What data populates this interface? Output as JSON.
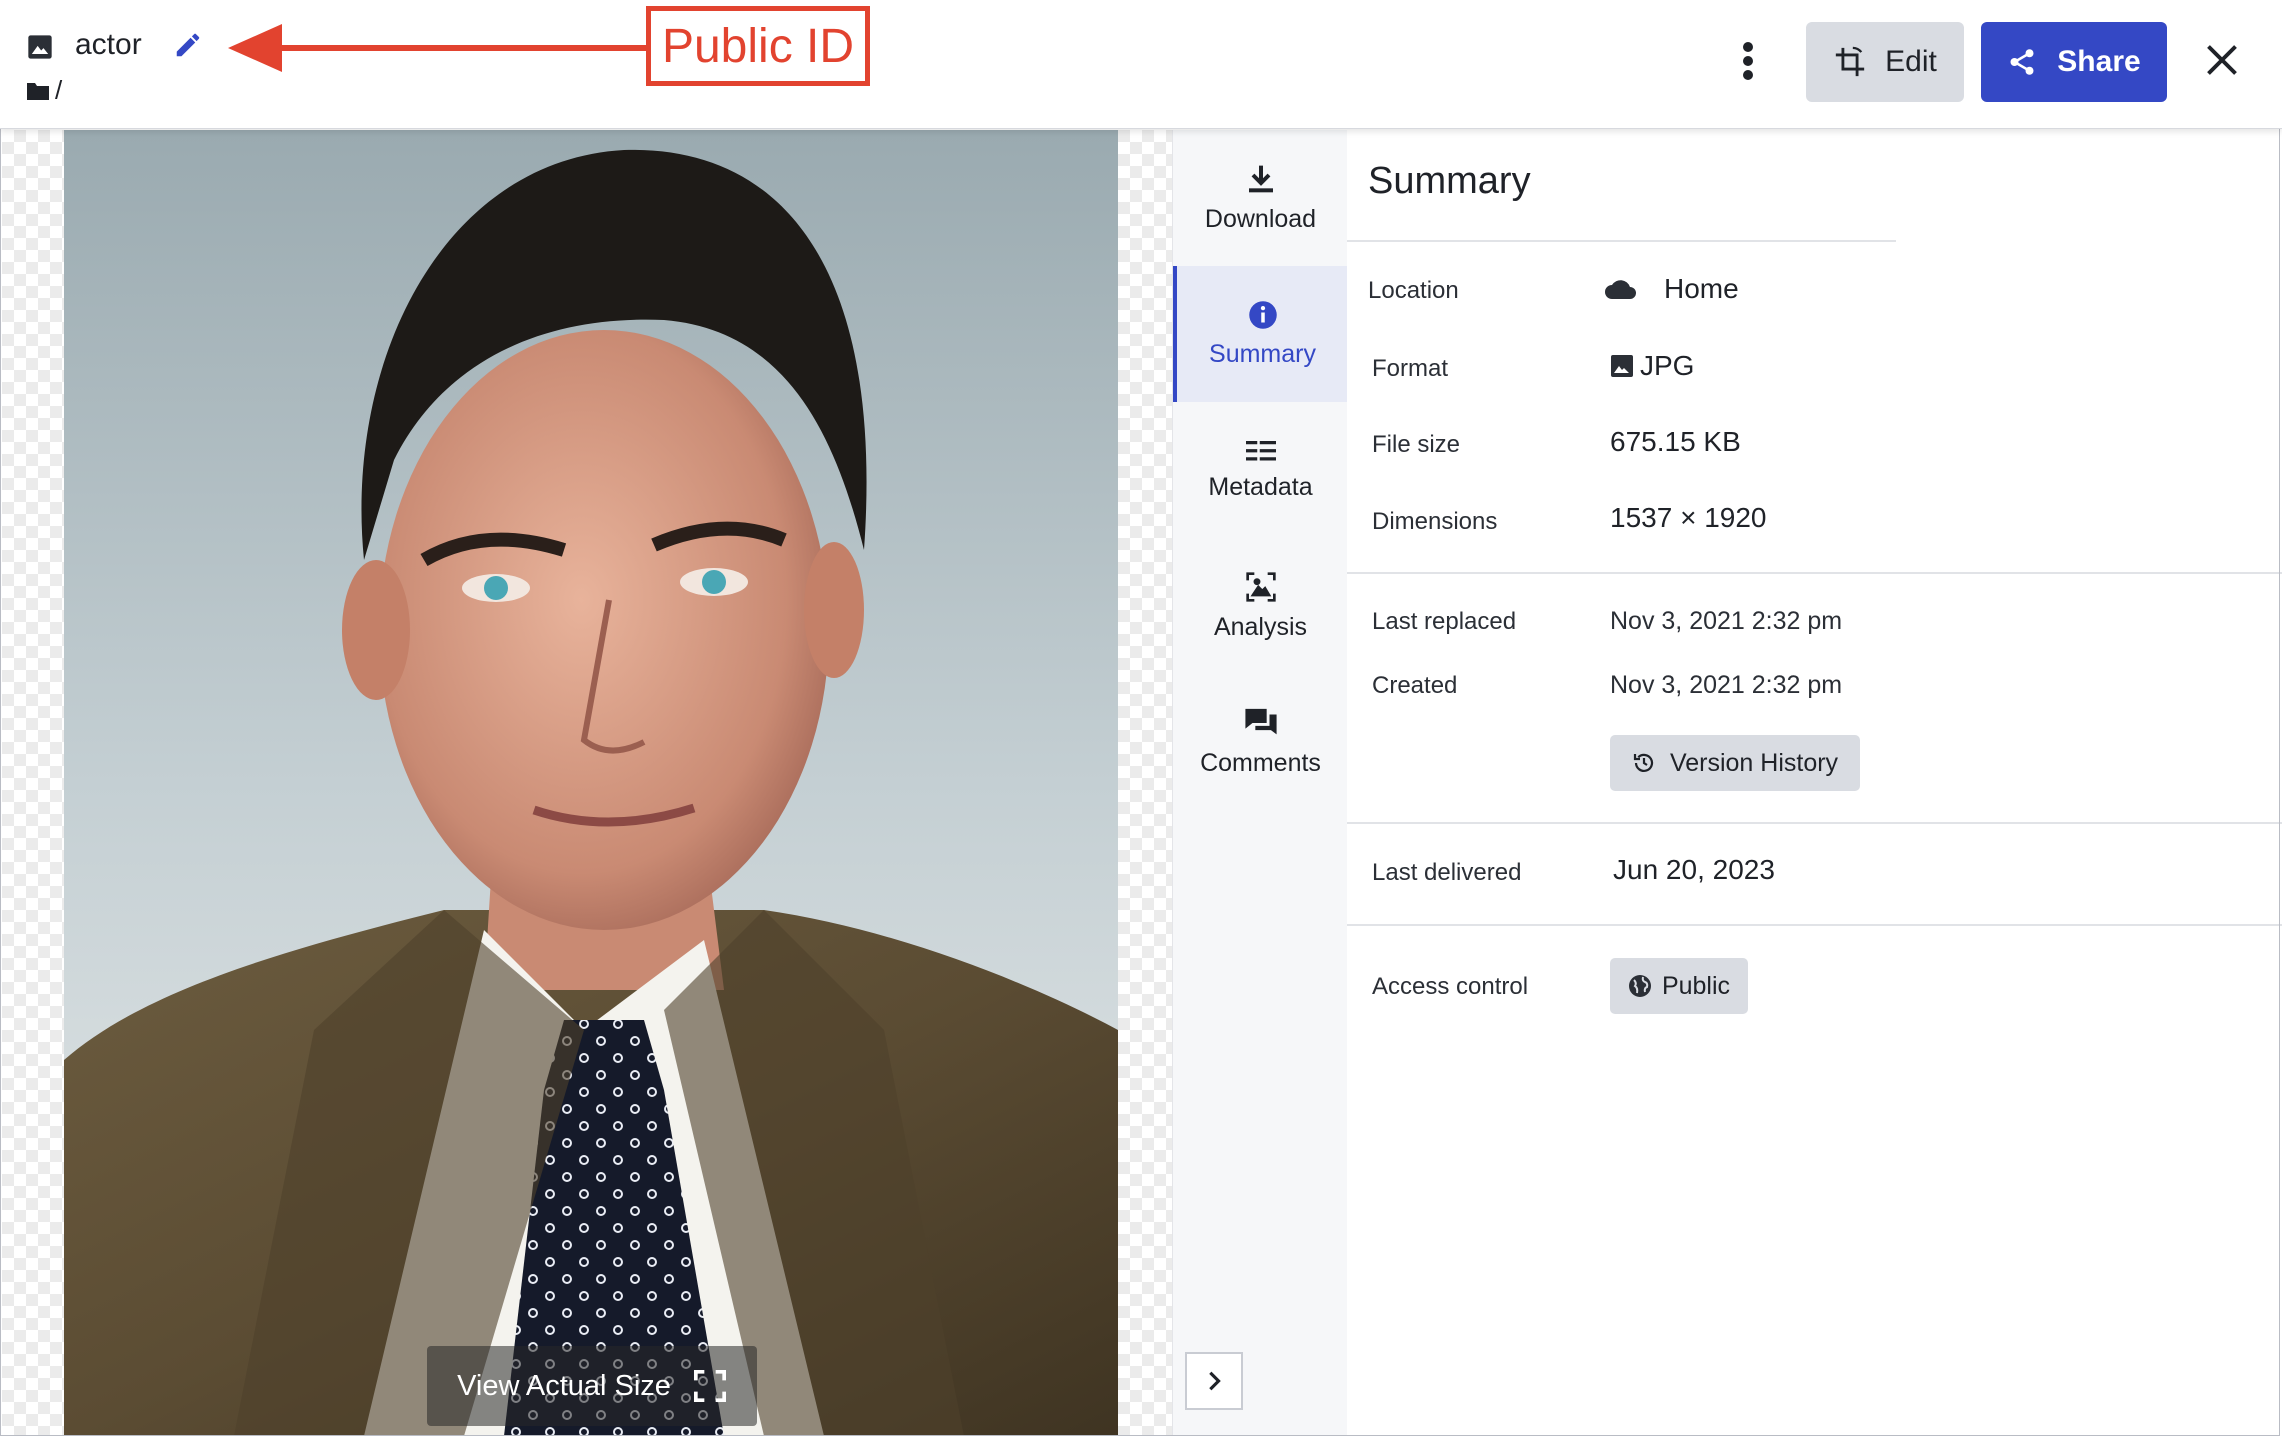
{
  "header": {
    "asset_type_icon": "image-icon",
    "asset_name": "actor",
    "edit_name_icon": "pencil-icon",
    "folder_icon": "folder-icon",
    "folder_path": "/",
    "annotation": {
      "label": "Public ID",
      "color": "#e2432f"
    },
    "more_icon": "more-vertical-icon",
    "edit_label": "Edit",
    "edit_icon": "crop-icon",
    "share_label": "Share",
    "share_icon": "share-icon",
    "close_icon": "close-icon"
  },
  "preview": {
    "view_actual_size_label": "View Actual Size",
    "fullscreen_icon": "fullscreen-icon"
  },
  "tabs": [
    {
      "label": "Download",
      "icon": "download-icon",
      "active": false
    },
    {
      "label": "Summary",
      "icon": "info-icon",
      "active": true
    },
    {
      "label": "Metadata",
      "icon": "list-icon",
      "active": false
    },
    {
      "label": "Analysis",
      "icon": "analysis-icon",
      "active": false
    },
    {
      "label": "Comments",
      "icon": "comments-icon",
      "active": false
    }
  ],
  "collapse_icon": "chevron-right-icon",
  "summary": {
    "title": "Summary",
    "location": {
      "label": "Location",
      "value": "Home",
      "icon": "cloud-icon"
    },
    "format": {
      "label": "Format",
      "value": "JPG",
      "icon": "image-icon"
    },
    "file_size": {
      "label": "File size",
      "value": "675.15 KB"
    },
    "dimensions": {
      "label": "Dimensions",
      "value": "1537 × 1920"
    },
    "last_replaced": {
      "label": "Last replaced",
      "value": "Nov 3, 2021 2:32 pm"
    },
    "created": {
      "label": "Created",
      "value": "Nov 3, 2021 2:32 pm"
    },
    "version_history": {
      "label": "Version History",
      "icon": "history-icon"
    },
    "last_delivered": {
      "label": "Last delivered",
      "value": "Jun 20, 2023"
    },
    "access_control": {
      "label": "Access control",
      "value": "Public",
      "icon": "globe-icon"
    }
  },
  "colors": {
    "accent": "#3448c5",
    "annotation": "#e2432f",
    "button_gray": "#d9dce2"
  }
}
